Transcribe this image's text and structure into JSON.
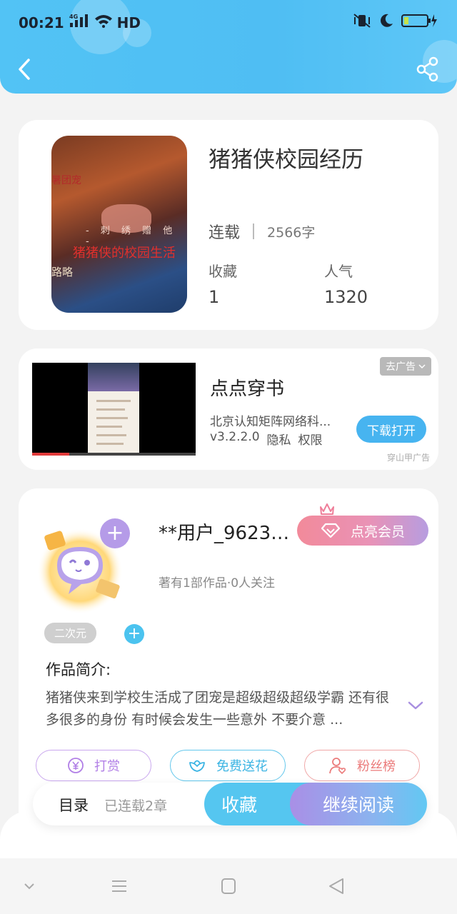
{
  "status_bar": {
    "time": "00:21",
    "network": "4G",
    "hd": "HD"
  },
  "header": {
    "back_icon": "chevron-left-icon",
    "share_icon": "share-icon"
  },
  "book": {
    "title": "猪猪侠校园经历",
    "status": "连载",
    "word_count": "2566字",
    "favorites_label": "收藏",
    "favorites_value": "1",
    "popularity_label": "人气",
    "popularity_value": "1320",
    "cover_text_1": "暑团宠",
    "cover_text_2": "- 刺 绣 赠 他 -",
    "cover_text_3": "猪猪侠的校园生活",
    "cover_text_4": "路略"
  },
  "ad": {
    "badge": "去广告",
    "title": "点点穿书",
    "description": "北京认知矩阵网络科...",
    "version": "v3.2.2.0",
    "privacy": "隐私",
    "permissions": "权限",
    "button": "下载打开",
    "source": "穿山甲广告"
  },
  "author": {
    "name": "**用户_96236...",
    "vip_button": "点亮会员",
    "meta": "著有1部作品·0人关注",
    "tag": "二次元",
    "intro_label": "作品简介:",
    "intro_text": "猪猪侠来到学校生活成了团宠是超级超级超级学霸 还有很多很多的身份 有时候会发生一些意外 不要介意 ..."
  },
  "actions": {
    "reward": "打赏",
    "flower": "免费送花",
    "fans": "粉丝榜"
  },
  "bottom_bar": {
    "toc": "目录",
    "chapters": "已连载2章",
    "favorite": "收藏",
    "continue": "继续阅读"
  },
  "colors": {
    "header": "#4fbef3",
    "accent_blue": "#55c6f0",
    "accent_purple": "#a98fe6",
    "vip_pink": "#f28a9a"
  }
}
